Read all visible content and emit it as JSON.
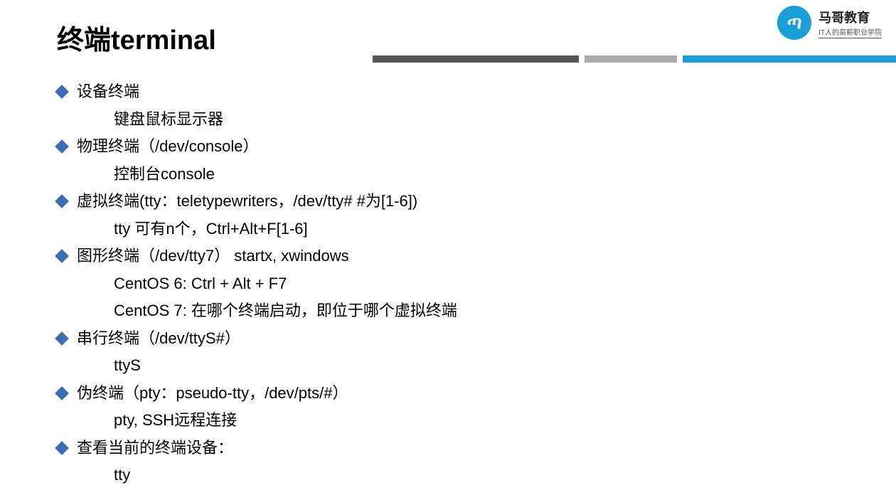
{
  "title": "终端terminal",
  "logo": {
    "glyph": "ጣ",
    "title": "马哥教育",
    "subtitle": "IT人的高薪职业学院"
  },
  "items": [
    {
      "heading": "设备终端",
      "subs": [
        "键盘鼠标显示器"
      ]
    },
    {
      "heading": "物理终端（/dev/console）",
      "subs": [
        "控制台console"
      ]
    },
    {
      "heading": "虚拟终端(tty：teletypewriters，/dev/tty#  #为[1-6])",
      "subs": [
        "tty 可有n个，Ctrl+Alt+F[1-6]"
      ]
    },
    {
      "heading": "图形终端（/dev/tty7） startx, xwindows",
      "subs": [
        "CentOS 6: Ctrl + Alt + F7",
        "CentOS 7: 在哪个终端启动，即位于哪个虚拟终端"
      ]
    },
    {
      "heading": "串行终端（/dev/ttyS#）",
      "subs": [
        "ttyS"
      ]
    },
    {
      "heading": "伪终端（pty：pseudo-tty，/dev/pts/#）",
      "subs": [
        "pty, SSH远程连接"
      ]
    },
    {
      "heading": "查看当前的终端设备：",
      "subs": [
        "tty"
      ]
    }
  ]
}
